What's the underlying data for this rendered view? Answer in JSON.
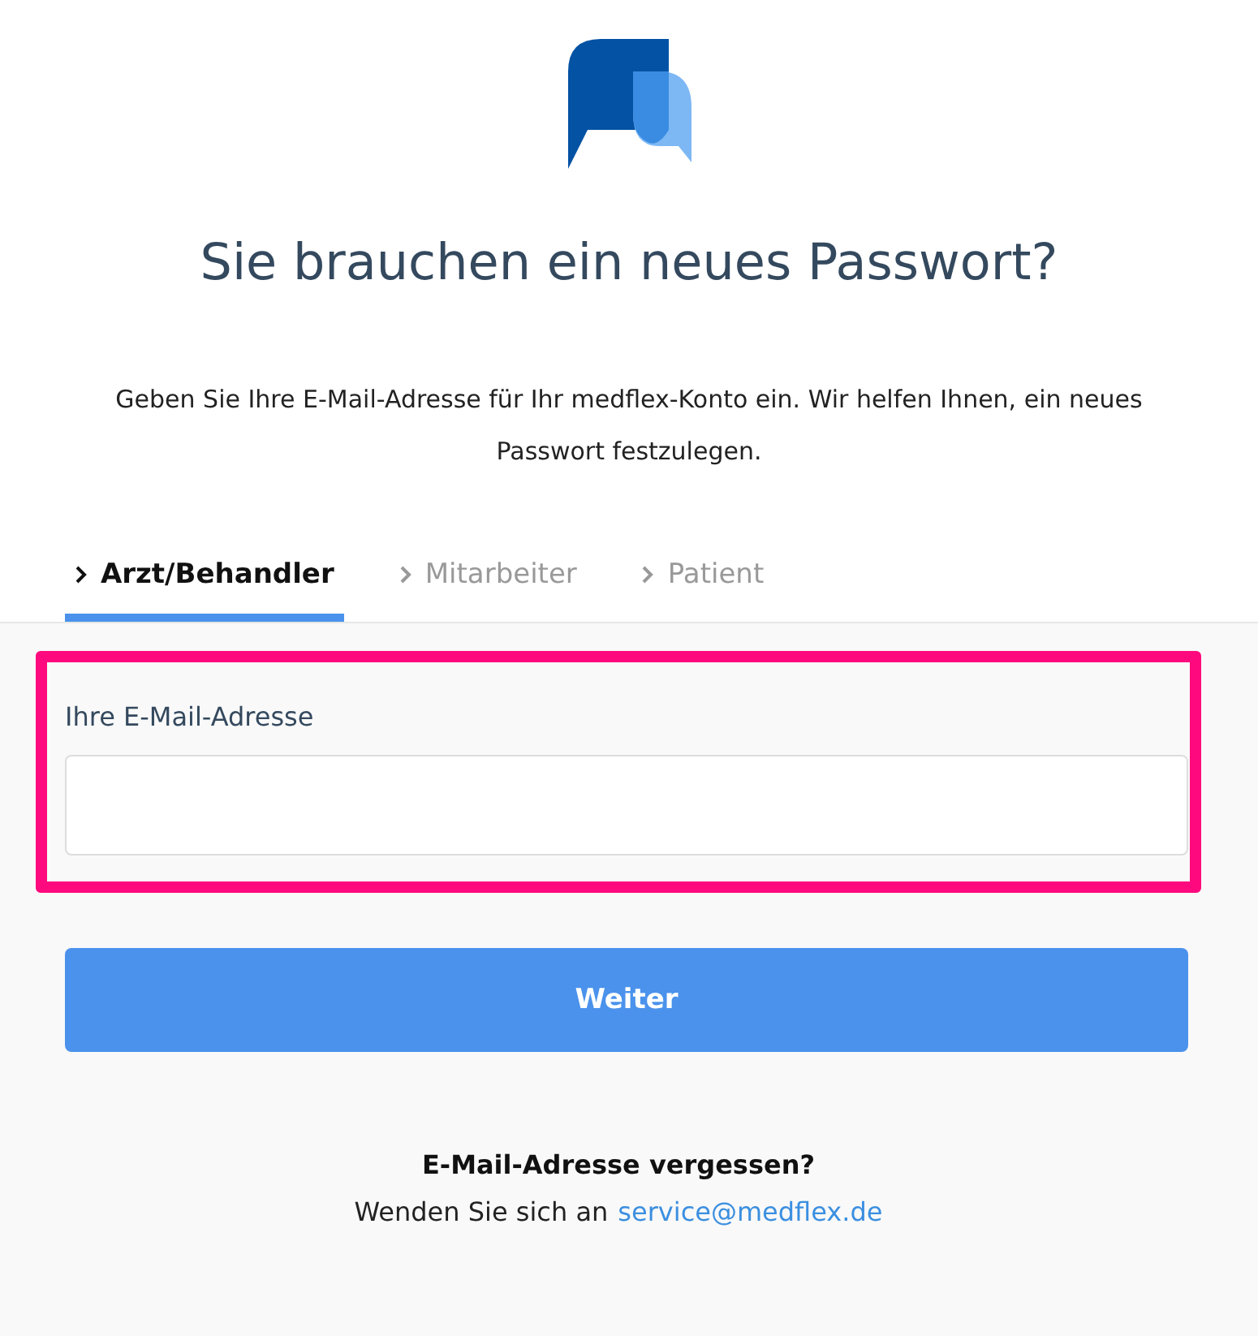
{
  "title": "Sie brauchen ein neues Passwort?",
  "intro": "Geben Sie Ihre E-Mail-Adresse für Ihr medflex-Konto ein. Wir helfen Ihnen, ein neues Passwort festzulegen.",
  "tabs": [
    {
      "label": "Arzt/Behandler",
      "selected": true
    },
    {
      "label": "Mitarbeiter",
      "selected": false
    },
    {
      "label": "Patient",
      "selected": false
    }
  ],
  "form": {
    "highlighted": true,
    "email_label": "Ihre E-Mail-Adresse",
    "submit": "Weiter"
  },
  "footer": {
    "heading": "E-Mail-Adresse vergessen?",
    "text": "Wenden Sie sich an",
    "link": "service@medflex.de"
  }
}
